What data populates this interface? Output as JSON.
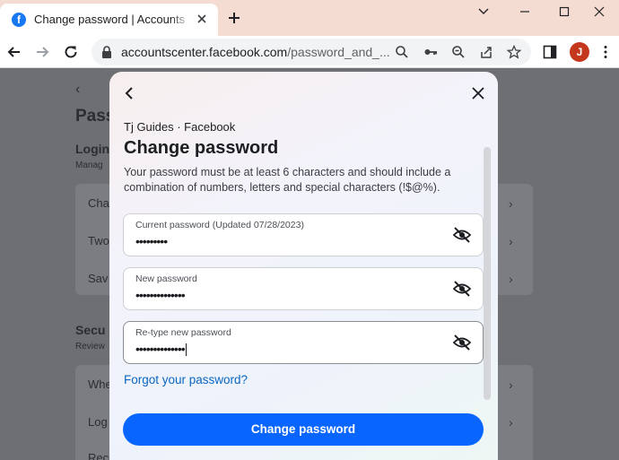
{
  "browser": {
    "tab": {
      "title": "Change password | Accounts Center",
      "favicon_letter": "f"
    },
    "address": {
      "host": "accountscenter.facebook.com",
      "path": "/password_and_..."
    },
    "profile_initial": "J",
    "colors": {
      "titlebar": "#f5dcd3",
      "avatar": "#c5371c"
    }
  },
  "background_page": {
    "heading_fragment": "Pass",
    "section1": {
      "title": "Login",
      "subtitle": "Manag"
    },
    "rows1": [
      "Cha",
      "Two",
      "Sav"
    ],
    "section2": {
      "title": "Secu",
      "subtitle": "Review"
    },
    "rows2": [
      "Whe",
      "Log",
      "Reco"
    ]
  },
  "modal": {
    "account_line": "Tj Guides · Facebook",
    "title": "Change password",
    "description": "Your password must be at least 6 characters and should include a combination of numbers, letters and special characters (!$@%).",
    "fields": [
      {
        "label": "Current password (Updated 07/28/2023)",
        "value": "•••••••••",
        "icon": "eye-slash-icon"
      },
      {
        "label": "New password",
        "value": "••••••••••••••",
        "icon": "eye-slash-icon"
      },
      {
        "label": "Re-type new password",
        "value": "••••••••••••••",
        "icon": "eye-slash-icon"
      }
    ],
    "forgot_link": "Forgot your password?",
    "submit_label": "Change password",
    "colors": {
      "primary": "#0866ff",
      "link": "#0a66c2"
    }
  }
}
